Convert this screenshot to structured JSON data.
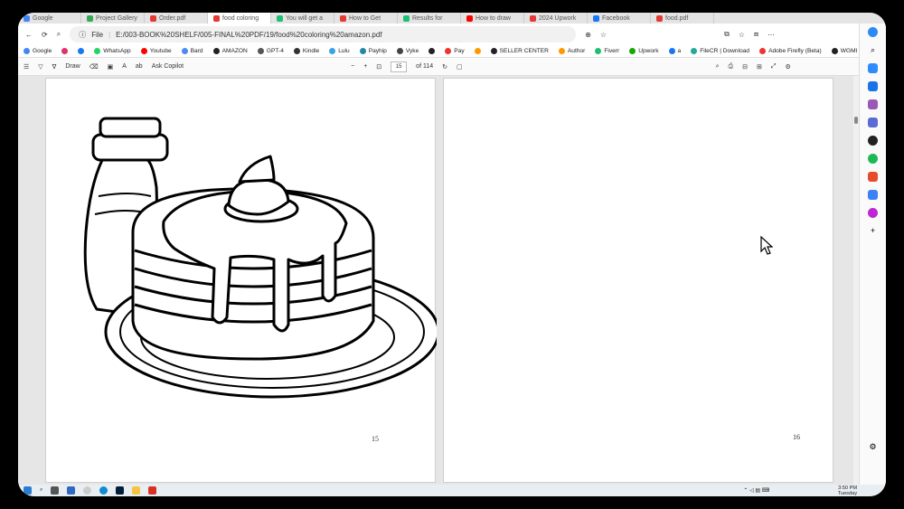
{
  "tabs": [
    {
      "label": "Google",
      "color": "#4285f4"
    },
    {
      "label": "Project Gallery",
      "color": "#34a853"
    },
    {
      "label": "Order.pdf",
      "color": "#e53935"
    },
    {
      "label": "food coloring",
      "color": "#e53935"
    },
    {
      "label": "You will get a",
      "color": "#1dbf73"
    },
    {
      "label": "How to Get",
      "color": "#e53935"
    },
    {
      "label": "Results for",
      "color": "#1dbf73"
    },
    {
      "label": "How to draw",
      "color": "#ff0000"
    },
    {
      "label": "2024 Upwork",
      "color": "#e53935"
    },
    {
      "label": "Facebook",
      "color": "#1877f2"
    },
    {
      "label": "food.pdf",
      "color": "#e53935"
    }
  ],
  "address": {
    "file_label": "File",
    "url": "E:/003-BOOK%20SHELF/005-FINAL%20PDF/19/food%20coloring%20amazon.pdf"
  },
  "bookmarks": [
    {
      "label": "Google",
      "color": "#4285f4"
    },
    {
      "label": "",
      "color": "#e1306c"
    },
    {
      "label": "",
      "color": "#1877f2"
    },
    {
      "label": "WhatsApp",
      "color": "#25d366"
    },
    {
      "label": "Youtube",
      "color": "#ff0000"
    },
    {
      "label": "Bard",
      "color": "#4c8bf5"
    },
    {
      "label": "AMAZON",
      "color": "#222"
    },
    {
      "label": "GPT-4",
      "color": "#555"
    },
    {
      "label": "Kindle",
      "color": "#333"
    },
    {
      "label": "Lulu",
      "color": "#3aa3e3"
    },
    {
      "label": "Payhip",
      "color": "#28a"
    },
    {
      "label": "Vyke",
      "color": "#444"
    },
    {
      "label": "",
      "color": "#222"
    },
    {
      "label": "Pay",
      "color": "#e33"
    },
    {
      "label": "",
      "color": "#f90"
    },
    {
      "label": "SELLER CENTER",
      "color": "#222"
    },
    {
      "label": "Author",
      "color": "#f90"
    },
    {
      "label": "Fiverr",
      "color": "#1dbf73"
    },
    {
      "label": "Upwork",
      "color": "#14a800"
    },
    {
      "label": "a",
      "color": "#1877f2"
    },
    {
      "label": "FileCR | Download",
      "color": "#2a9"
    },
    {
      "label": "Adobe Firefly (Beta)",
      "color": "#e33"
    },
    {
      "label": "WGMI Media - Cura...",
      "color": "#222"
    }
  ],
  "pdf_toolbar": {
    "draw_label": "Draw",
    "ask_label": "Ask Copilot",
    "zoom_minus": "−",
    "zoom_plus": "+",
    "page_current": "15",
    "page_total": "of 114"
  },
  "pages": {
    "left_number": "15",
    "right_number": "16"
  },
  "taskbar": {
    "time": "3:50 PM",
    "day": "Tuesday"
  }
}
